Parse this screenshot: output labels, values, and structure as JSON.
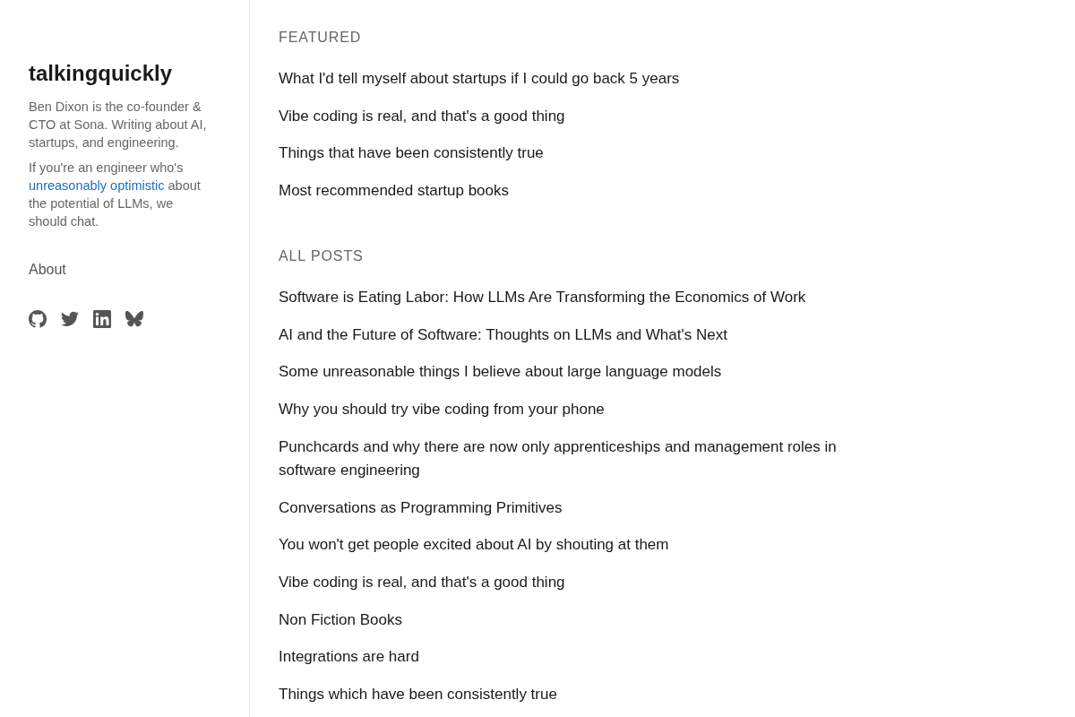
{
  "sidebar": {
    "site_title": "talkingquickly",
    "bio": "Ben Dixon is the co-founder & CTO at Sona. Writing about AI, startups, and engineering.",
    "intro": {
      "before": "If you're an engineer who's ",
      "link": "unreasonably optimistic",
      "after": " about the potential of LLMs, we should chat."
    },
    "nav": [
      "About"
    ]
  },
  "sections": [
    {
      "heading": "FEATURED",
      "posts": [
        "What I'd tell myself about startups if I could go back 5 years",
        "Vibe coding is real, and that's a good thing",
        "Things that have been consistently true",
        "Most recommended startup books"
      ]
    },
    {
      "heading": "ALL POSTS",
      "posts": [
        "Software is Eating Labor: How LLMs Are Transforming the Economics of Work",
        "AI and the Future of Software: Thoughts on LLMs and What's Next",
        "Some unreasonable things I believe about large language models",
        "Why you should try vibe coding from your phone",
        "Punchcards and why there are now only apprenticeships and management roles in software engineering",
        "Conversations as Programming Primitives",
        "You won't get people excited about AI by shouting at them",
        "Vibe coding is real, and that's a good thing",
        "Non Fiction Books",
        "Integrations are hard",
        "Things which have been consistently true"
      ]
    }
  ]
}
